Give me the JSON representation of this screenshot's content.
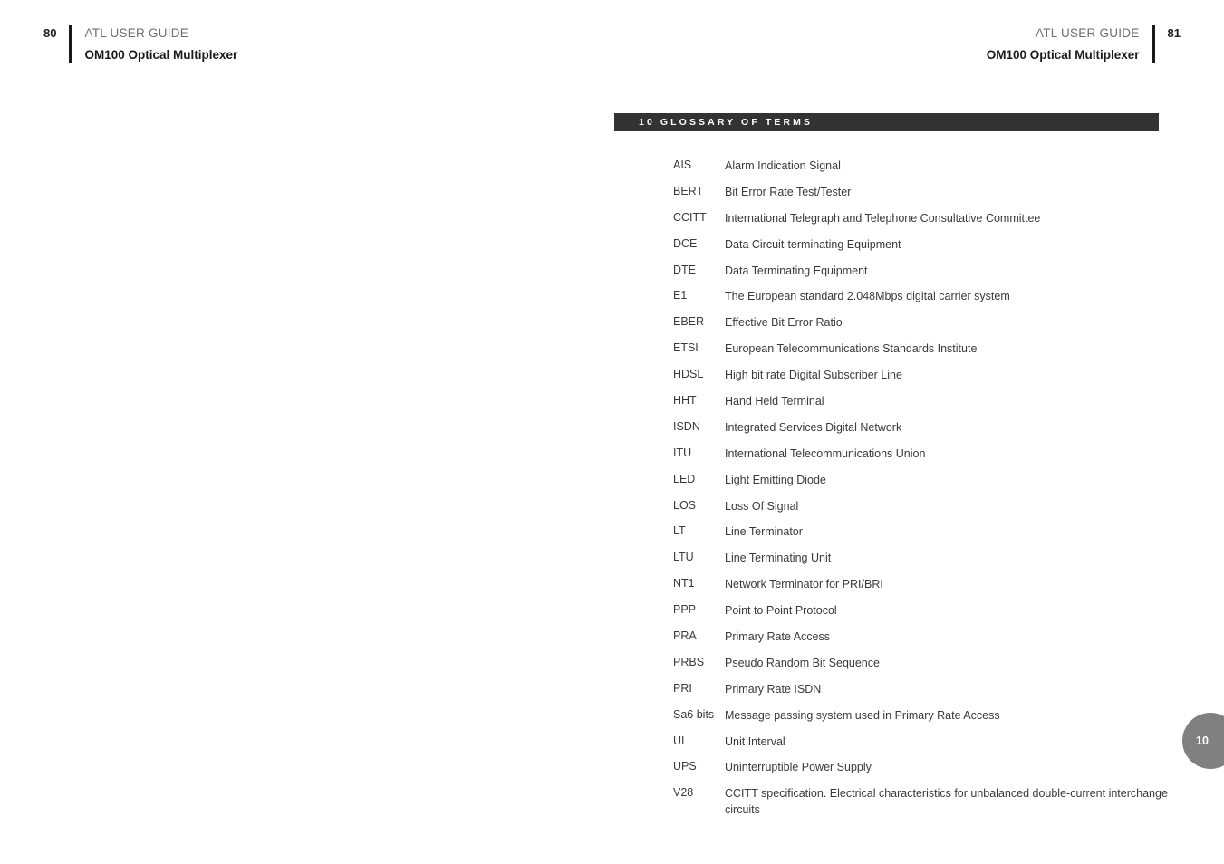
{
  "left_header": {
    "folio": "80",
    "guide_title": "ATL USER GUIDE",
    "product_title": "OM100 Optical Multiplexer"
  },
  "right_header": {
    "folio": "81",
    "guide_title": "ATL USER GUIDE",
    "product_title": "OM100 Optical Multiplexer"
  },
  "section": {
    "banner_text": "10  GLOSSARY OF TERMS",
    "banner_bg": "#333333",
    "banner_fg": "#ffffff"
  },
  "thumb_tab": {
    "number": "10",
    "color": "#808080"
  },
  "glossary": {
    "entries": [
      {
        "term": "AIS",
        "definition": "Alarm Indication Signal"
      },
      {
        "term": "BERT",
        "definition": "Bit Error Rate Test/Tester"
      },
      {
        "term": "CCITT",
        "definition": "International Telegraph and Telephone Consultative Committee"
      },
      {
        "term": "DCE",
        "definition": "Data Circuit-terminating Equipment"
      },
      {
        "term": "DTE",
        "definition": "Data Terminating Equipment"
      },
      {
        "term": "E1",
        "definition": "The European standard 2.048Mbps digital carrier system"
      },
      {
        "term": "EBER",
        "definition": "Effective Bit Error Ratio"
      },
      {
        "term": "ETSI",
        "definition": "European Telecommunications Standards Institute"
      },
      {
        "term": "HDSL",
        "definition": "High bit rate Digital Subscriber Line"
      },
      {
        "term": "HHT",
        "definition": "Hand Held Terminal"
      },
      {
        "term": "ISDN",
        "definition": "Integrated Services Digital Network"
      },
      {
        "term": "ITU",
        "definition": "International Telecommunications Union"
      },
      {
        "term": "LED",
        "definition": "Light Emitting Diode"
      },
      {
        "term": "LOS",
        "definition": "Loss Of Signal"
      },
      {
        "term": "LT",
        "definition": "Line Terminator"
      },
      {
        "term": "LTU",
        "definition": "Line Terminating Unit"
      },
      {
        "term": "NT1",
        "definition": "Network Terminator for PRI/BRI"
      },
      {
        "term": "PPP",
        "definition": "Point to Point Protocol"
      },
      {
        "term": "PRA",
        "definition": "Primary Rate Access"
      },
      {
        "term": "PRBS",
        "definition": "Pseudo Random Bit Sequence"
      },
      {
        "term": "PRI",
        "definition": "Primary Rate ISDN"
      },
      {
        "term": "Sa6 bits",
        "definition": "Message passing system used in Primary Rate Access"
      },
      {
        "term": "UI",
        "definition": "Unit Interval"
      },
      {
        "term": "UPS",
        "definition": "Uninterruptible Power Supply"
      },
      {
        "term": "V28",
        "definition": "CCITT specification. Electrical characteristics for unbalanced double-current interchange circuits"
      }
    ]
  }
}
